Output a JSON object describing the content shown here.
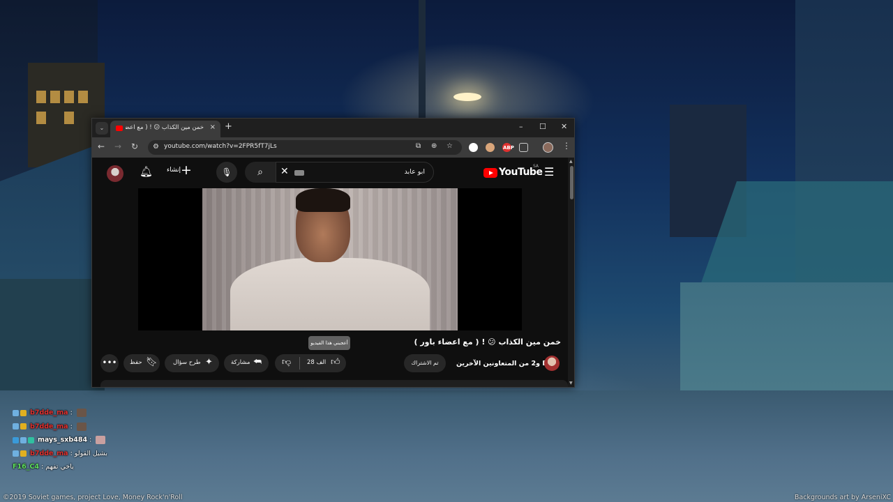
{
  "browser": {
    "tab_title": "خمن مين الكذاب 😕 ! ( مع اعضاء",
    "url": "youtube.com/watch?v=2FPR5fT7jLs",
    "new_tab_symbol": "+",
    "tab_close_symbol": "×",
    "tab_dropdown_symbol": "⌄",
    "window_controls": {
      "minimize": "–",
      "maximize": "☐",
      "close": "✕"
    },
    "nav": {
      "back": "←",
      "forward": "→",
      "reload": "↻"
    },
    "extensions": [
      {
        "name": "extension-diamond",
        "color": "#ffffff"
      },
      {
        "name": "extension-face",
        "color": "#d9a57a"
      },
      {
        "name": "extension-abp",
        "color": "#e0312f",
        "label": "ABP"
      },
      {
        "name": "extensions-puzzle",
        "color": "#cccccc"
      }
    ]
  },
  "youtube": {
    "create_label": "إنشاء",
    "search_query": "ابو عابد",
    "logo_text": "YouTube",
    "region": "SA",
    "video": {
      "title": "خمن مين الكذاب 😕 ! ( مع اعضاء باور )",
      "channel": "B7 و2 من المتعاونين الآخرين",
      "subscribe_label": "تم الاشتراك",
      "likes": "28 الف",
      "tooltip": "أعجبني هذا الفيديو",
      "share_label": "مشاركة",
      "ask_label": "طرح سؤال",
      "save_label": "حفظ",
      "more_symbol": "•••"
    }
  },
  "chat": [
    {
      "user": "b7dde_ma",
      "message": "",
      "color": "#e0312f"
    },
    {
      "user": "b7dde_ma",
      "message": "",
      "color": "#e0312f"
    },
    {
      "user": "mays_sxb484",
      "message": "",
      "color": "#ffffff"
    },
    {
      "user": "b7dde_ma",
      "message": "بشيل القولو",
      "color": "#e0312f"
    },
    {
      "user": "F16_C4",
      "message": "ياخي تفهم",
      "color": "#5fe05f"
    }
  ],
  "credits": {
    "left": "©2019 Soviet games, project Love, Money Rock'n'Roll",
    "right": "Backgrounds art by ArseniXC"
  },
  "colors": {
    "youtube_red": "#ff0000",
    "dark_bg": "#0f0f0f",
    "chip_bg": "#272727"
  }
}
